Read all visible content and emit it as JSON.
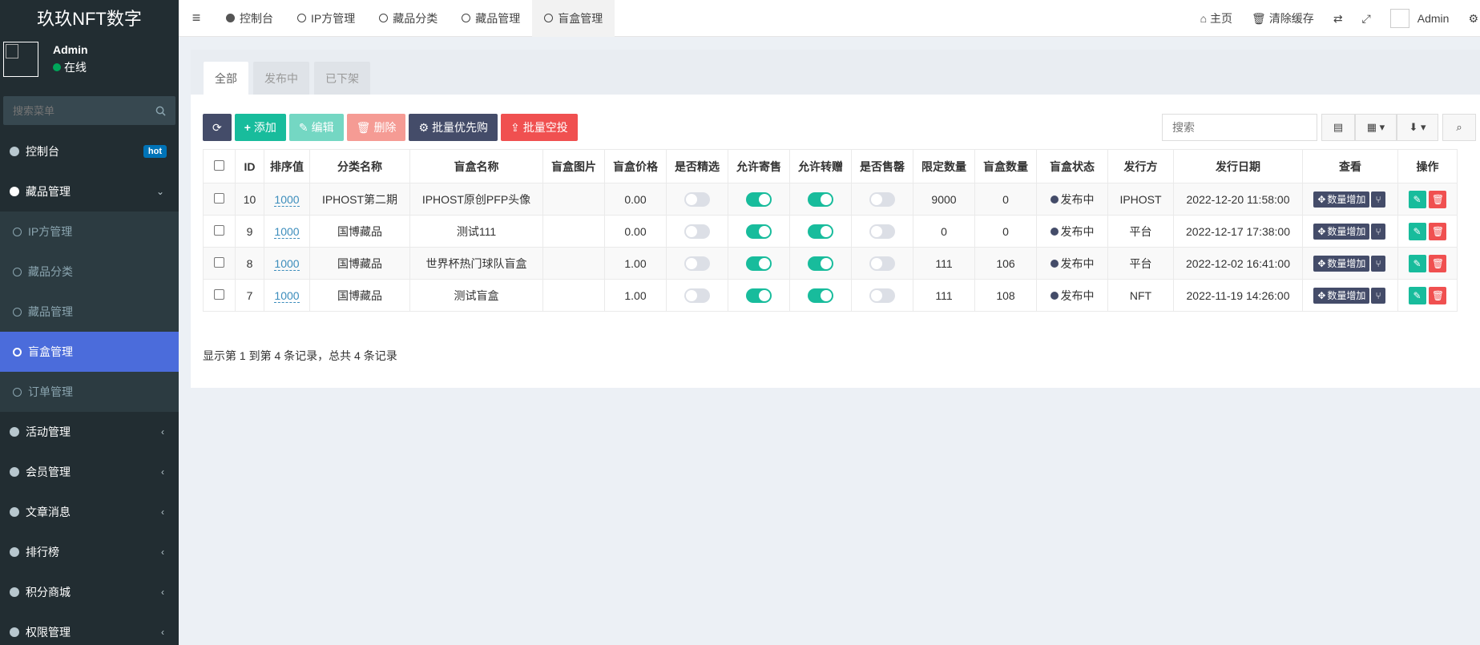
{
  "app": {
    "title": "玖玖NFT数字"
  },
  "user": {
    "name": "Admin",
    "status": "在线"
  },
  "sidebar": {
    "search_placeholder": "搜索菜单",
    "items": [
      {
        "label": "控制台",
        "badge": "hot"
      },
      {
        "label": "藏品管理",
        "expanded": true,
        "children": [
          "IP方管理",
          "藏品分类",
          "藏品管理",
          "盲盒管理",
          "订单管理"
        ]
      },
      {
        "label": "活动管理"
      },
      {
        "label": "会员管理"
      },
      {
        "label": "文章消息"
      },
      {
        "label": "排行榜"
      },
      {
        "label": "积分商城"
      },
      {
        "label": "权限管理"
      }
    ],
    "active_child": "盲盒管理"
  },
  "topnav": {
    "tabs": [
      "控制台",
      "IP方管理",
      "藏品分类",
      "藏品管理",
      "盲盒管理"
    ],
    "right": {
      "home": "主页",
      "clear_cache": "清除缓存",
      "user": "Admin"
    }
  },
  "panel": {
    "tabs": [
      "全部",
      "发布中",
      "已下架"
    ],
    "toolbar": {
      "add": "添加",
      "edit": "编辑",
      "delete": "删除",
      "batch_priority": "批量优先购",
      "batch_airdrop": "批量空投",
      "search_placeholder": "搜索"
    },
    "columns": [
      "ID",
      "排序值",
      "分类名称",
      "盲盒名称",
      "盲盒图片",
      "盲盒价格",
      "是否精选",
      "允许寄售",
      "允许转赠",
      "是否售罄",
      "限定数量",
      "盲盒数量",
      "盲盒状态",
      "发行方",
      "发行日期",
      "查看",
      "操作"
    ],
    "rows": [
      {
        "id": "10",
        "sort": "1000",
        "category": "IPHOST第二期",
        "name": "IPHOST原创PFP头像",
        "price": "0.00",
        "featured": false,
        "consign": true,
        "transfer": true,
        "soldout": false,
        "limit": "9000",
        "count": "0",
        "status": "发布中",
        "issuer": "IPHOST",
        "date": "2022-12-20 11:58:00"
      },
      {
        "id": "9",
        "sort": "1000",
        "category": "国博藏品",
        "name": "测试111",
        "price": "0.00",
        "featured": false,
        "consign": true,
        "transfer": true,
        "soldout": false,
        "limit": "0",
        "count": "0",
        "status": "发布中",
        "issuer": "平台",
        "date": "2022-12-17 17:38:00"
      },
      {
        "id": "8",
        "sort": "1000",
        "category": "国博藏品",
        "name": "世界杯热门球队盲盒",
        "price": "1.00",
        "featured": false,
        "consign": true,
        "transfer": true,
        "soldout": false,
        "limit": "111",
        "count": "106",
        "status": "发布中",
        "issuer": "平台",
        "date": "2022-12-02 16:41:00"
      },
      {
        "id": "7",
        "sort": "1000",
        "category": "国博藏品",
        "name": "测试盲盒",
        "price": "1.00",
        "featured": false,
        "consign": true,
        "transfer": true,
        "soldout": false,
        "limit": "111",
        "count": "108",
        "status": "发布中",
        "issuer": "NFT",
        "date": "2022-11-19 14:26:00"
      }
    ],
    "view_button": "数量增加",
    "footer": "显示第 1 到第 4 条记录，总共 4 条记录"
  },
  "colors": {
    "sidebar_bg": "#222d32",
    "active": "#4b6cdb",
    "green": "#18bc9c",
    "red": "#f05050",
    "dark": "#444c69"
  }
}
